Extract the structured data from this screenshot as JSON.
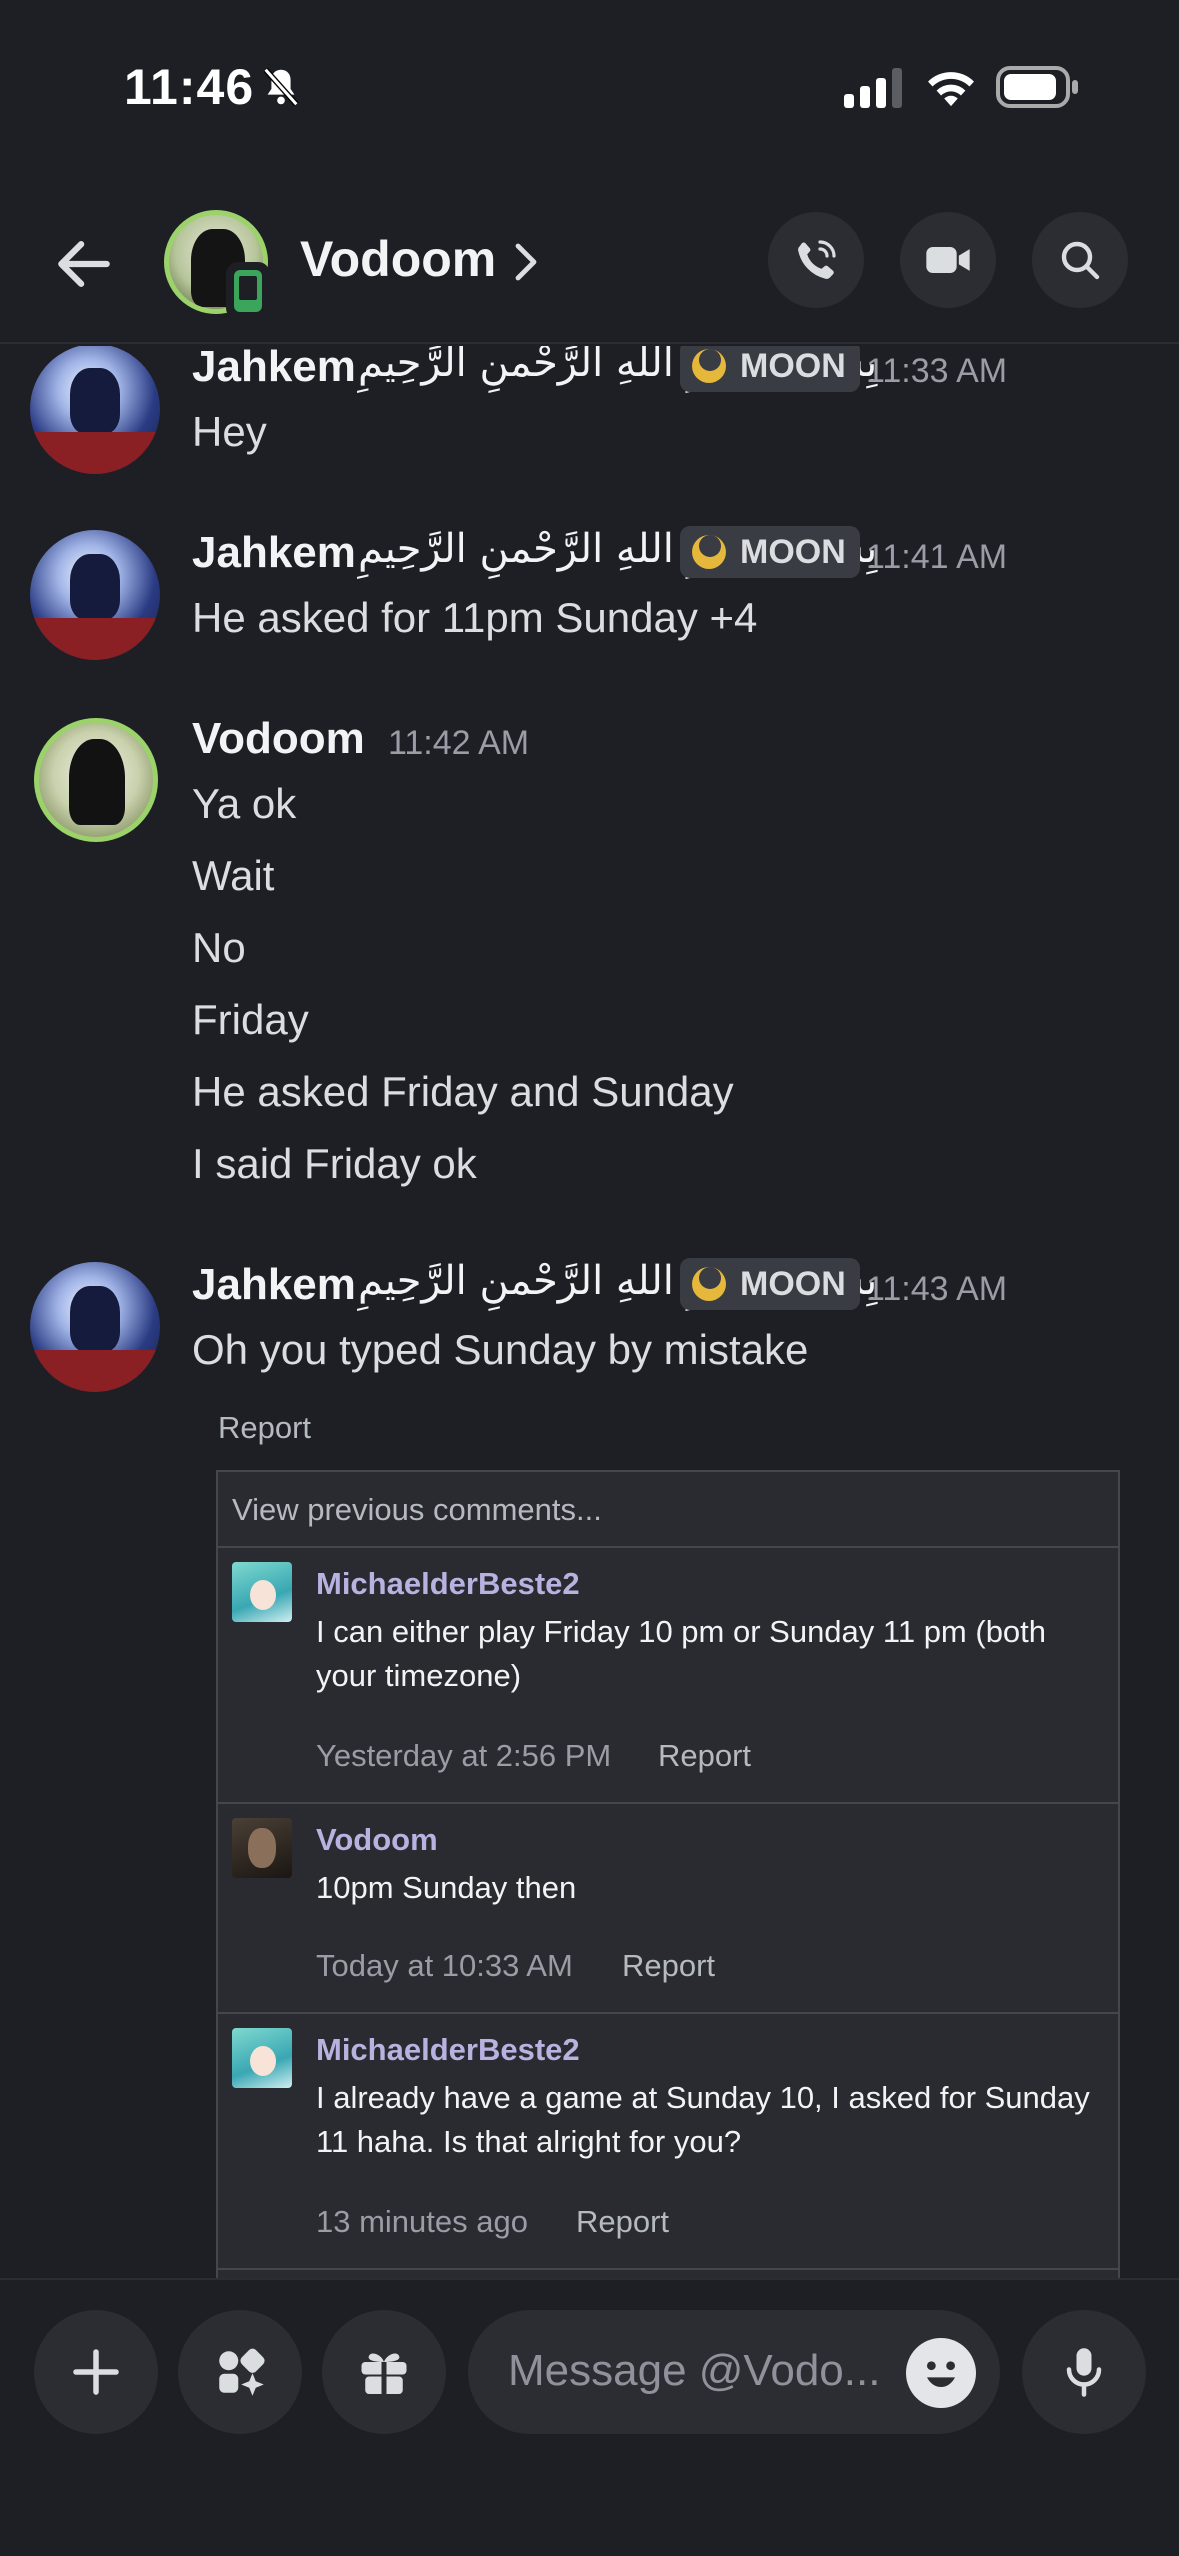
{
  "status_bar": {
    "time": "11:46"
  },
  "header": {
    "name": "Vodoom"
  },
  "messages": [
    {
      "author": "Jahkem",
      "name_suffix": "بِسْــــــــــمِ اللهِ الرَّحْمنِ الرَّحِيمِ",
      "tag": "MOON",
      "time": "11:33 AM",
      "lines": [
        "Hey"
      ]
    },
    {
      "author": "Jahkem",
      "name_suffix": "بِسْــــــــــمِ اللهِ الرَّحْمنِ الرَّحِيمِ",
      "tag": "MOON",
      "time": "11:41 AM",
      "lines": [
        "He asked for 11pm Sunday +4"
      ]
    },
    {
      "author": "Vodoom",
      "time": "11:42 AM",
      "lines": [
        "Ya ok",
        "Wait",
        "No",
        "Friday",
        "He asked Friday and Sunday",
        "I said Friday ok"
      ]
    },
    {
      "author": "Jahkem",
      "name_suffix": "بِسْــــــــــمِ اللهِ الرَّحْمنِ الرَّحِيمِ",
      "tag": "MOON",
      "time": "11:43 AM",
      "lines": [
        "Oh you typed Sunday by mistake"
      ]
    }
  ],
  "embed": {
    "report_label": "Report",
    "view_previous": "View previous comments...",
    "comments": [
      {
        "name": "MichaelderBeste2",
        "text": "I can either play Friday 10 pm or Sunday 11 pm (both your timezone)",
        "meta": "Yesterday at 2:56 PM",
        "report": "Report"
      },
      {
        "name": "Vodoom",
        "text": "10pm Sunday then",
        "meta": "Today at 10:33 AM",
        "report": "Report"
      },
      {
        "name": "MichaelderBeste2",
        "text": "I already have a game at Sunday 10, I asked for Sunday 11 haha. Is that alright for you?",
        "meta": "13 minutes ago",
        "report": "Report"
      }
    ]
  },
  "composer": {
    "placeholder": "Message @Vodo..."
  },
  "colors": {
    "background": "#1e1f25",
    "moon_badge": "#e5b73b",
    "online_green": "#3ba55c",
    "comment_name": "#b9b1e0"
  }
}
